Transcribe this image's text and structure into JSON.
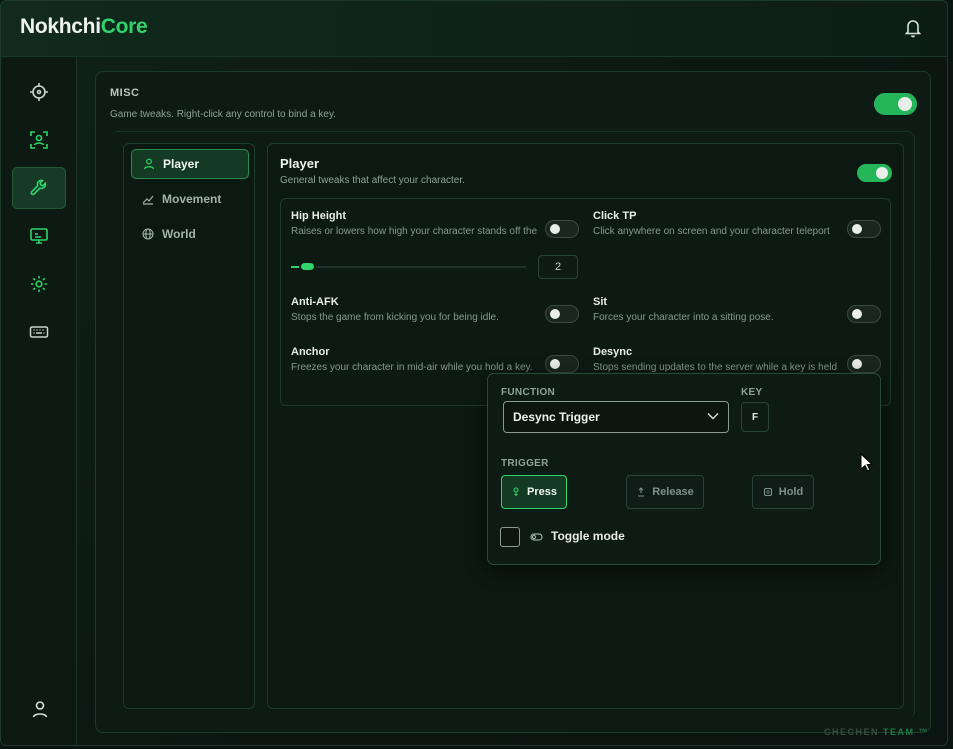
{
  "app": {
    "logo_primary": "Nokhchi",
    "logo_accent": "Core",
    "brand_color": "#2fd46a"
  },
  "sidebar": {
    "items": [
      {
        "icon": "crosshair-icon",
        "active": false
      },
      {
        "icon": "focus-frame-icon",
        "active": false
      },
      {
        "icon": "wrench-icon",
        "active": true
      },
      {
        "icon": "monitor-icon",
        "active": false
      },
      {
        "icon": "gear-icon",
        "active": false
      },
      {
        "icon": "keyboard-icon",
        "active": false
      }
    ],
    "bottom_icon": "user-icon"
  },
  "misc": {
    "title": "MISC",
    "description": "Game tweaks. Right-click any control to bind a key.",
    "enabled": true
  },
  "categories": [
    {
      "label": "Player",
      "icon": "person-icon",
      "active": true
    },
    {
      "label": "Movement",
      "icon": "trend-icon",
      "active": false
    },
    {
      "label": "World",
      "icon": "globe-icon",
      "active": false
    }
  ],
  "player": {
    "title": "Player",
    "description": "General tweaks that affect your character.",
    "enabled": true,
    "options": {
      "hip_height": {
        "title": "Hip Height",
        "desc": "Raises or lowers how high your character stands off the",
        "enabled": false,
        "value": "2"
      },
      "click_tp": {
        "title": "Click TP",
        "desc": "Click anywhere on screen and your character teleport",
        "enabled": false
      },
      "anti_afk": {
        "title": "Anti-AFK",
        "desc": "Stops the game from kicking you for being idle.",
        "enabled": false
      },
      "sit": {
        "title": "Sit",
        "desc": "Forces your character into a sitting pose.",
        "enabled": false
      },
      "anchor": {
        "title": "Anchor",
        "desc": "Freezes your character in mid-air while you hold a key.",
        "enabled": false
      },
      "desync": {
        "title": "Desync",
        "desc": "Stops sending updates to the server while a key is held",
        "enabled": false
      }
    }
  },
  "bind_popup": {
    "function_label": "FUNCTION",
    "function_value": "Desync Trigger",
    "key_label": "KEY",
    "key_value": "F",
    "trigger_label": "TRIGGER",
    "triggers": [
      {
        "label": "Press",
        "icon": "press-icon",
        "active": true
      },
      {
        "label": "Release",
        "icon": "release-icon",
        "active": false
      },
      {
        "label": "Hold",
        "icon": "hold-icon",
        "active": false
      }
    ],
    "toggle_mode_label": "Toggle mode",
    "toggle_mode_checked": false
  },
  "watermark": {
    "part1": "CHECHEN ",
    "part2": "TEAM ™"
  }
}
